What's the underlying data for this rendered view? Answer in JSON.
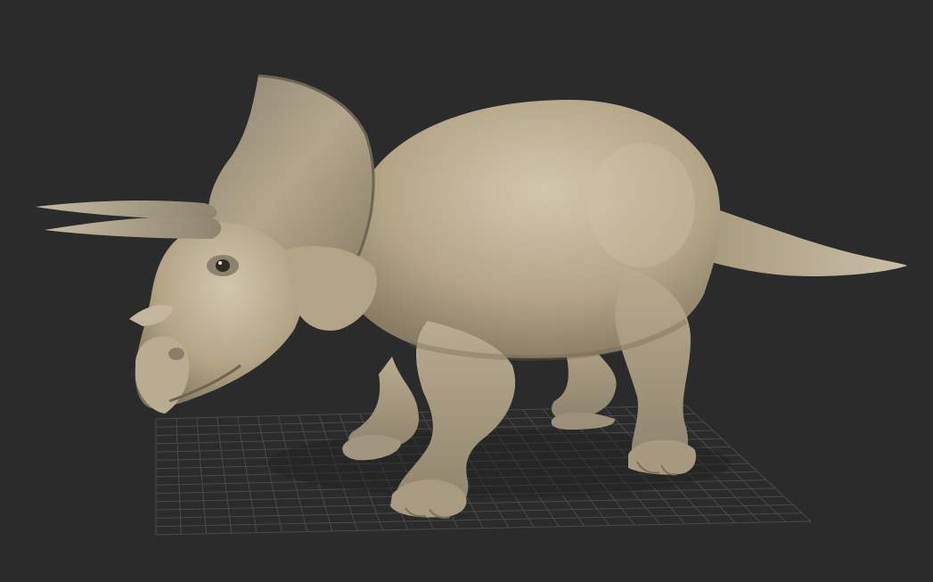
{
  "viewport": {
    "background_color": "#2b2b2b",
    "grid_color": "#4a4a4a",
    "grid_visible": true
  },
  "model": {
    "subject": "triceratops",
    "skin_color": "#b7a88c",
    "skin_shadow_color": "#6f6450",
    "skin_highlight_color": "#d6cbb4"
  }
}
